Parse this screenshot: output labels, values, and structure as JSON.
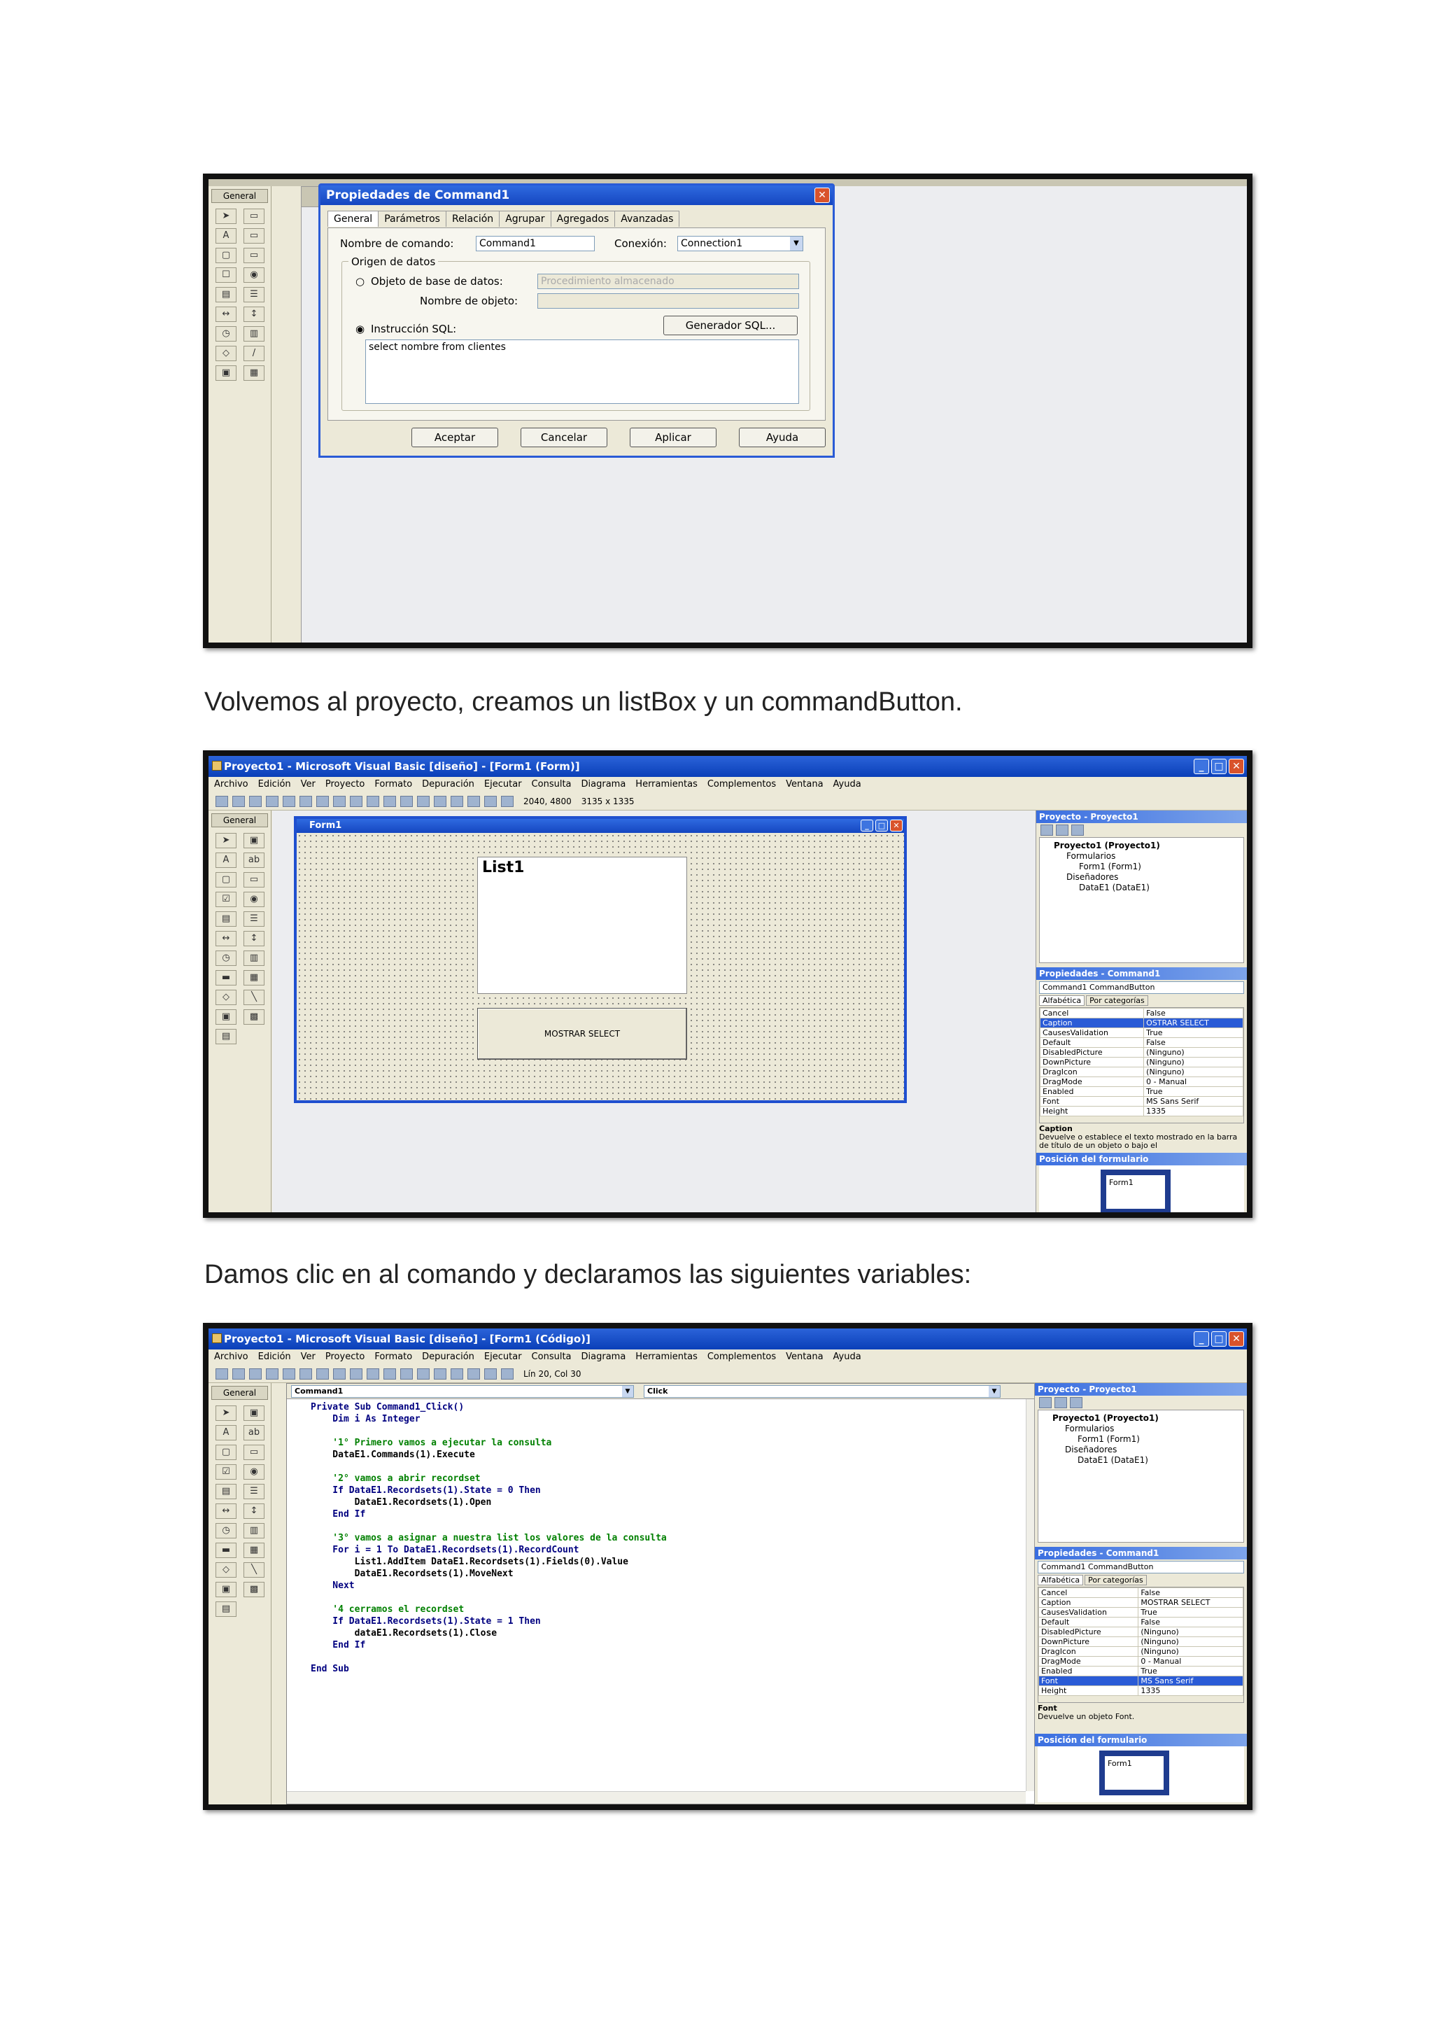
{
  "captions": {
    "one": "Volvemos al proyecto, creamos un listBox y un commandButton.",
    "two": "Damos clic en al comando y declaramos las siguientes variables:"
  },
  "shot1": {
    "toolbox_title": "General",
    "dialog": {
      "title": "Propiedades de Command1",
      "tabs": [
        "General",
        "Parámetros",
        "Relación",
        "Agrupar",
        "Agregados",
        "Avanzadas"
      ],
      "command_name_label": "Nombre de comando:",
      "command_name_value": "Command1",
      "connection_label": "Conexión:",
      "connection_value": "Connection1",
      "source_group": "Origen de datos",
      "db_object_label": "Objeto de base de datos:",
      "db_object_value": "Procedimiento almacenado",
      "object_name_label": "Nombre de objeto:",
      "sql_label": "Instrucción SQL:",
      "sql_builder": "Generador SQL...",
      "sql_text": "select nombre from clientes",
      "buttons": [
        "Aceptar",
        "Cancelar",
        "Aplicar",
        "Ayuda"
      ]
    }
  },
  "shot2": {
    "title": "Proyecto1 - Microsoft Visual Basic [diseño] - [Form1 (Form)]",
    "menu": [
      "Archivo",
      "Edición",
      "Ver",
      "Proyecto",
      "Formato",
      "Depuración",
      "Ejecutar",
      "Consulta",
      "Diagrama",
      "Herramientas",
      "Complementos",
      "Ventana",
      "Ayuda"
    ],
    "coords_pos": "2040, 4800",
    "coords_size": "3135 x 1335",
    "toolbox_title": "General",
    "form_title": "Form1",
    "list_label": "List1",
    "button_label": "MOSTRAR SELECT",
    "project_title": "Proyecto - Proyecto1",
    "tree": [
      "Proyecto1 (Proyecto1)",
      "Formularios",
      "Form1 (Form1)",
      "Diseñadores",
      "DataE1 (DataE1)"
    ],
    "props_title": "Propiedades - Command1",
    "props_object": "Command1 CommandButton",
    "props_tabs": [
      "Alfabética",
      "Por categorías"
    ],
    "props": [
      [
        "Cancel",
        "False"
      ],
      [
        "Caption",
        "OSTRAR SELECT"
      ],
      [
        "CausesValidation",
        "True"
      ],
      [
        "Default",
        "False"
      ],
      [
        "DisabledPicture",
        "(Ninguno)"
      ],
      [
        "DownPicture",
        "(Ninguno)"
      ],
      [
        "DragIcon",
        "(Ninguno)"
      ],
      [
        "DragMode",
        "0 - Manual"
      ],
      [
        "Enabled",
        "True"
      ],
      [
        "Font",
        "MS Sans Serif"
      ],
      [
        "Height",
        "1335"
      ]
    ],
    "selected_prop": 1,
    "desc_title": "Caption",
    "desc_text": "Devuelve o establece el texto mostrado en la barra de título de un objeto o bajo el",
    "layout_title": "Posición del formulario",
    "layout_form": "Form1"
  },
  "shot3": {
    "title": "Proyecto1 - Microsoft Visual Basic [diseño] - [Form1 (Código)]",
    "menu": [
      "Archivo",
      "Edición",
      "Ver",
      "Proyecto",
      "Formato",
      "Depuración",
      "Ejecutar",
      "Consulta",
      "Diagrama",
      "Herramientas",
      "Complementos",
      "Ventana",
      "Ayuda"
    ],
    "cursor_pos": "Lín 20, Col 30",
    "toolbox_title": "General",
    "object_combo": "Command1",
    "proc_combo": "Click",
    "code": [
      {
        "t": "kw",
        "s": "Private Sub Command1_Click()"
      },
      {
        "t": "kw",
        "s": "    Dim i As Integer"
      },
      {
        "t": "tx",
        "s": ""
      },
      {
        "t": "cm",
        "s": "    '1° Primero vamos a ejecutar la consulta"
      },
      {
        "t": "tx",
        "s": "    DataE1.Commands(1).Execute"
      },
      {
        "t": "tx",
        "s": ""
      },
      {
        "t": "cm",
        "s": "    '2° vamos a abrir recordset"
      },
      {
        "t": "kw",
        "s": "    If DataE1.Recordsets(1).State = 0 Then"
      },
      {
        "t": "tx",
        "s": "        DataE1.Recordsets(1).Open"
      },
      {
        "t": "kw",
        "s": "    End If"
      },
      {
        "t": "tx",
        "s": ""
      },
      {
        "t": "cm",
        "s": "    '3° vamos a asignar a nuestra list los valores de la consulta"
      },
      {
        "t": "kw",
        "s": "    For i = 1 To DataE1.Recordsets(1).RecordCount"
      },
      {
        "t": "tx",
        "s": "        List1.AddItem DataE1.Recordsets(1).Fields(0).Value"
      },
      {
        "t": "tx",
        "s": "        DataE1.Recordsets(1).MoveNext"
      },
      {
        "t": "kw",
        "s": "    Next"
      },
      {
        "t": "tx",
        "s": ""
      },
      {
        "t": "cm",
        "s": "    '4 cerramos el recordset"
      },
      {
        "t": "kw",
        "s": "    If DataE1.Recordsets(1).State = 1 Then"
      },
      {
        "t": "tx",
        "s": "        dataE1.Recordsets(1).Close"
      },
      {
        "t": "kw",
        "s": "    End If"
      },
      {
        "t": "tx",
        "s": ""
      },
      {
        "t": "kw",
        "s": "End Sub"
      }
    ],
    "project_title": "Proyecto - Proyecto1",
    "tree": [
      "Proyecto1 (Proyecto1)",
      "Formularios",
      "Form1 (Form1)",
      "Diseñadores",
      "DataE1 (DataE1)"
    ],
    "props_title": "Propiedades - Command1",
    "props_object": "Command1 CommandButton",
    "props_tabs": [
      "Alfabética",
      "Por categorías"
    ],
    "props": [
      [
        "Cancel",
        "False"
      ],
      [
        "Caption",
        "MOSTRAR SELECT"
      ],
      [
        "CausesValidation",
        "True"
      ],
      [
        "Default",
        "False"
      ],
      [
        "DisabledPicture",
        "(Ninguno)"
      ],
      [
        "DownPicture",
        "(Ninguno)"
      ],
      [
        "DragIcon",
        "(Ninguno)"
      ],
      [
        "DragMode",
        "0 - Manual"
      ],
      [
        "Enabled",
        "True"
      ],
      [
        "Font",
        "MS Sans Serif"
      ],
      [
        "Height",
        "1335"
      ]
    ],
    "selected_prop": 9,
    "desc_title": "Font",
    "desc_text": "Devuelve un objeto Font.",
    "layout_title": "Posición del formulario",
    "layout_form": "Form1"
  },
  "colors": {
    "xp_titlebar": "#0a3fb8",
    "dialog_border": "#2a5bd6",
    "form_title": "#1f4fcf",
    "code_keyword": "#000080",
    "code_comment": "#008000"
  },
  "icons": [
    "close-icon",
    "minimize-icon",
    "maximize-icon",
    "pointer-icon",
    "label-tool-icon",
    "textbox-tool-icon",
    "checkbox-icon",
    "radio-icon",
    "folder-icon",
    "form-icon"
  ]
}
